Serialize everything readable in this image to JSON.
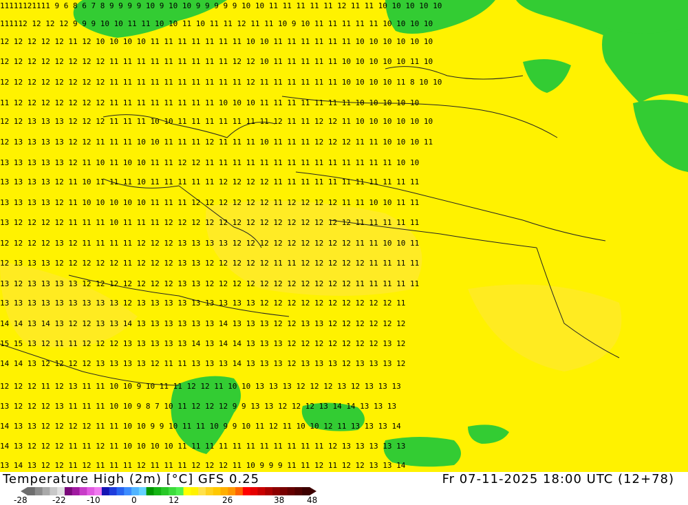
{
  "map": {
    "background": "#fff200",
    "warm_patch": "#ffde2a",
    "cold_patch": "#33cc33",
    "deep_cold": "#2bb52b",
    "border_color": "#222222"
  },
  "footer": {
    "title": "Temperature High (2m) [°C] GFS 0.25",
    "validity": "Fr 07-11-2025 18:00 UTC (12+78)"
  },
  "legend": {
    "colors": [
      "#6e6e6e",
      "#8c8c8c",
      "#a9a9a9",
      "#c8c8c8",
      "#e0e0e0",
      "#7a0a7a",
      "#a01aa0",
      "#c83cc8",
      "#e25ae2",
      "#f07af0",
      "#1414b4",
      "#1e3cdc",
      "#2864f0",
      "#3c8cff",
      "#50b4ff",
      "#64d2ff",
      "#009600",
      "#14b414",
      "#28c828",
      "#3cdc3c",
      "#50f050",
      "#ffff00",
      "#fff200",
      "#ffe14b",
      "#ffd21e",
      "#ffc800",
      "#ffaf00",
      "#ff9600",
      "#ff6400",
      "#ff0000",
      "#e60000",
      "#c80000",
      "#aa0000",
      "#8c0000",
      "#780000",
      "#640000",
      "#500000",
      "#3c0000"
    ],
    "labels": [
      "-28",
      "-22",
      "-10",
      "0",
      "12",
      "26",
      "38",
      "48"
    ]
  }
}
